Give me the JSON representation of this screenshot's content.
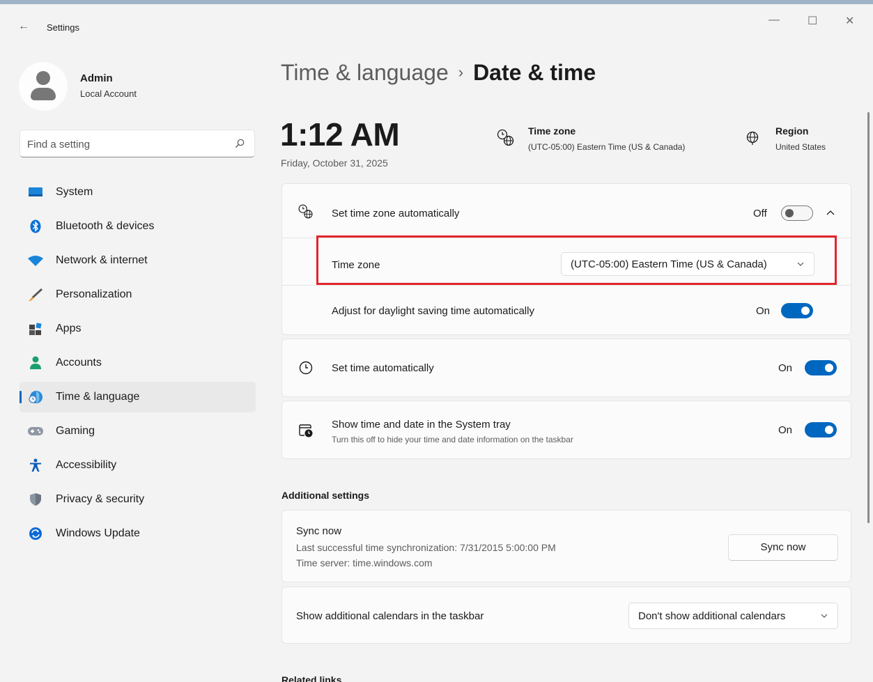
{
  "window": {
    "title": "Settings",
    "controls": {
      "minimize": "—",
      "maximize": "☐",
      "close": "✕"
    }
  },
  "profile": {
    "name": "Admin",
    "account_type": "Local Account"
  },
  "search": {
    "placeholder": "Find a setting"
  },
  "sidebar": {
    "items": [
      {
        "label": "System",
        "icon": "system-icon",
        "active": false
      },
      {
        "label": "Bluetooth & devices",
        "icon": "bluetooth-icon",
        "active": false
      },
      {
        "label": "Network & internet",
        "icon": "wifi-icon",
        "active": false
      },
      {
        "label": "Personalization",
        "icon": "brush-icon",
        "active": false
      },
      {
        "label": "Apps",
        "icon": "apps-icon",
        "active": false
      },
      {
        "label": "Accounts",
        "icon": "accounts-icon",
        "active": false
      },
      {
        "label": "Time & language",
        "icon": "time-language-icon",
        "active": true
      },
      {
        "label": "Gaming",
        "icon": "gamepad-icon",
        "active": false
      },
      {
        "label": "Accessibility",
        "icon": "accessibility-icon",
        "active": false
      },
      {
        "label": "Privacy & security",
        "icon": "shield-icon",
        "active": false
      },
      {
        "label": "Windows Update",
        "icon": "update-icon",
        "active": false
      }
    ]
  },
  "breadcrumb": {
    "parent": "Time & language",
    "separator": "›",
    "current": "Date & time"
  },
  "clock": {
    "time": "1:12 AM",
    "date": "Friday, October 31, 2025"
  },
  "summary": {
    "time_zone": {
      "title": "Time zone",
      "value": "(UTC-05:00) Eastern Time (US & Canada)"
    },
    "region": {
      "title": "Region",
      "value": "United States"
    }
  },
  "timezone_card": {
    "auto_label": "Set time zone automatically",
    "auto_state": "Off",
    "tz_label": "Time zone",
    "tz_value": "(UTC-05:00) Eastern Time (US & Canada)",
    "dst_label": "Adjust for daylight saving time automatically",
    "dst_state": "On"
  },
  "set_time_card": {
    "label": "Set time automatically",
    "state": "On"
  },
  "tray_card": {
    "label": "Show time and date in the System tray",
    "sublabel": "Turn this off to hide your time and date information on the taskbar",
    "state": "On"
  },
  "additional": {
    "heading": "Additional settings",
    "sync": {
      "title": "Sync now",
      "last_sync": "Last successful time synchronization: 7/31/2015 5:00:00 PM",
      "server": "Time server: time.windows.com",
      "button": "Sync now"
    },
    "calendars": {
      "label": "Show additional calendars in the taskbar",
      "value": "Don't show additional calendars"
    }
  },
  "related": {
    "heading": "Related links"
  },
  "colors": {
    "accent": "#0067c0",
    "highlight": "#e3242b",
    "background": "#f3f3f3"
  }
}
